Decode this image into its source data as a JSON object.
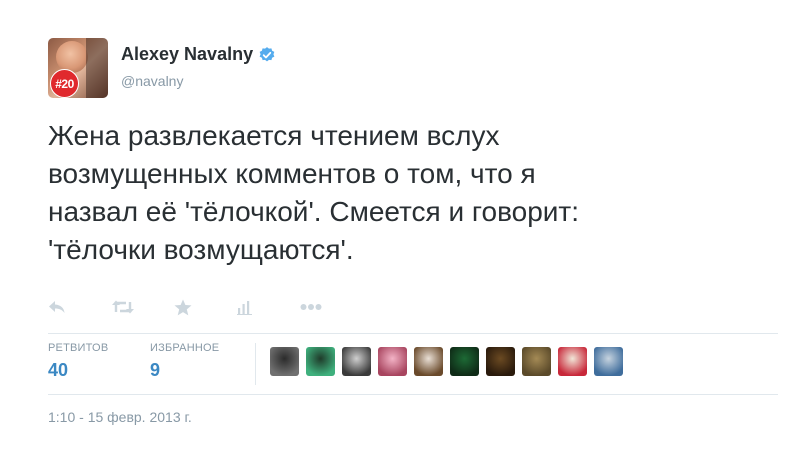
{
  "author": {
    "name": "Alexey Navalny",
    "handle": "@navalny",
    "avatar_badge": "#20",
    "verified": true
  },
  "tweet": {
    "text": "Жена развлекается чтением вслух\nвозмущенных комментов о том, что я\nназвал её 'тёлочкой'. Смеется и говорит:\n'тёлочки возмущаются'."
  },
  "actions": [
    {
      "name": "reply",
      "icon": "reply-icon"
    },
    {
      "name": "retweet",
      "icon": "retweet-icon"
    },
    {
      "name": "favorite",
      "icon": "star-icon"
    },
    {
      "name": "stats",
      "icon": "bar-chart-icon"
    },
    {
      "name": "more",
      "icon": "more-icon"
    }
  ],
  "stats": {
    "retweets_label": "РЕТВИТОВ",
    "retweets_value": "40",
    "favorites_label": "ИЗБРАННОЕ",
    "favorites_value": "9"
  },
  "favoriters": [
    {
      "name": "favoriter-1",
      "colors": [
        "#2b2b2b",
        "#707070"
      ]
    },
    {
      "name": "favoriter-2",
      "colors": [
        "#1f3b2a",
        "#3fb07d"
      ]
    },
    {
      "name": "favoriter-3",
      "colors": [
        "#cfcfcf",
        "#3b3b3b"
      ]
    },
    {
      "name": "favoriter-4",
      "colors": [
        "#f3b3c6",
        "#a8455f"
      ]
    },
    {
      "name": "favoriter-5",
      "colors": [
        "#e9dfd5",
        "#6a4a2b"
      ]
    },
    {
      "name": "favoriter-6",
      "colors": [
        "#1d6a35",
        "#0f2b17"
      ]
    },
    {
      "name": "favoriter-7",
      "colors": [
        "#6b4a22",
        "#2a1a0c"
      ]
    },
    {
      "name": "favoriter-8",
      "colors": [
        "#a48a55",
        "#5b4a2a"
      ]
    },
    {
      "name": "favoriter-9",
      "colors": [
        "#f1e6d8",
        "#c8283a"
      ]
    },
    {
      "name": "favoriter-10",
      "colors": [
        "#c6d3df",
        "#3f6d9c"
      ]
    }
  ],
  "timestamp": "1:10 - 15 февр. 2013 г.",
  "colors": {
    "text": "#292f33",
    "muted": "#8899a6",
    "link": "#3b88c3",
    "verified": "#55acee",
    "divider": "#e1e8ed"
  }
}
